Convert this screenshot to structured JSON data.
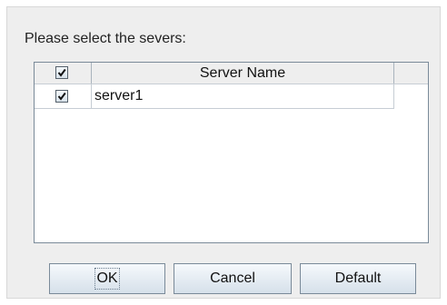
{
  "dialog": {
    "prompt": "Please select the severs:"
  },
  "table": {
    "header": {
      "select_all_checked": true,
      "name_column": "Server Name"
    },
    "rows": [
      {
        "checked": true,
        "name": "server1"
      }
    ]
  },
  "buttons": {
    "ok": "OK",
    "cancel": "Cancel",
    "default": "Default"
  }
}
